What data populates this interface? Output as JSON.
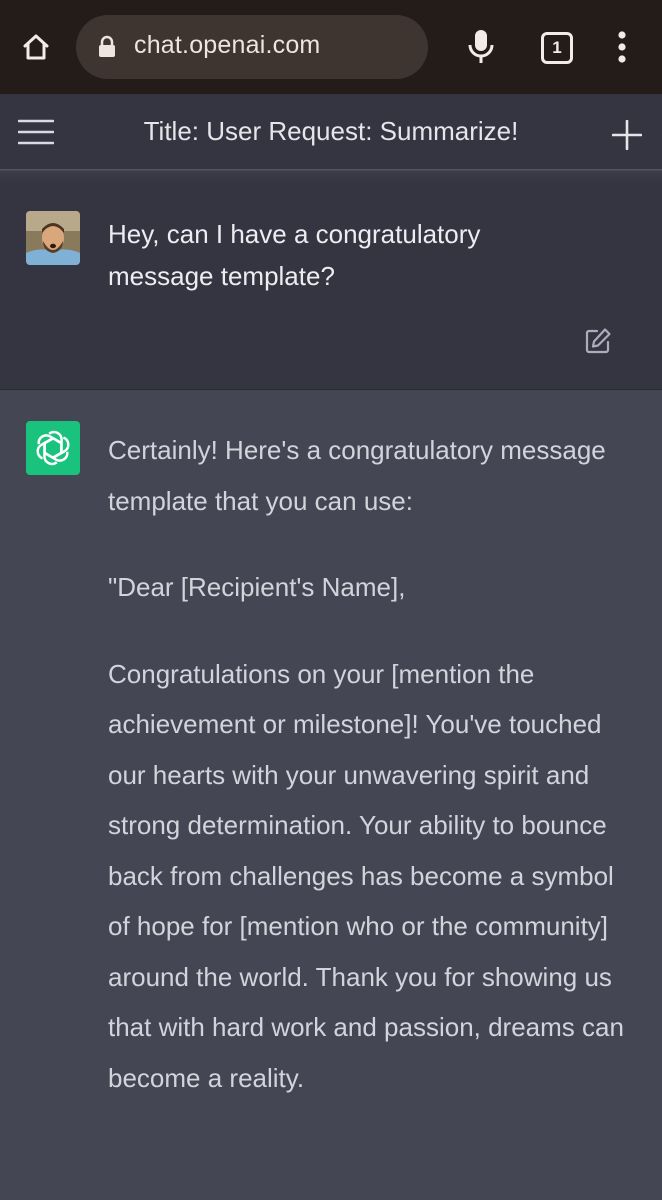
{
  "browser": {
    "url": "chat.openai.com",
    "tab_count": "1"
  },
  "header": {
    "title": "Title: User Request: Summarize!"
  },
  "user_message": {
    "text": "Hey, can I have a congratulatory\nmessage template?"
  },
  "assistant_message": {
    "paragraphs": [
      "Certainly! Here's a congratulatory message template that you can use:",
      "\"Dear [Recipient's Name],",
      "Congratulations on your [mention the achievement or milestone]! You've touched our hearts with your unwavering spirit and strong determination. Your ability to bounce back from challenges has become a symbol of hope for [mention who or the community] around the world. Thank you for showing us that with hard work and passion, dreams can become a reality."
    ]
  },
  "icons": {
    "home": "home-icon",
    "lock": "lock-icon",
    "mic": "microphone-icon",
    "tabs": "tab-switcher-icon",
    "kebab": "more-vert-icon",
    "menu": "hamburger-menu-icon",
    "new_chat": "plus-icon",
    "edit": "edit-icon",
    "gpt": "openai-logo-icon"
  },
  "colors": {
    "browser_bar": "#241c18",
    "header_bg": "#343541",
    "assistant_bg": "#444654",
    "gpt_green": "#19c37d"
  }
}
